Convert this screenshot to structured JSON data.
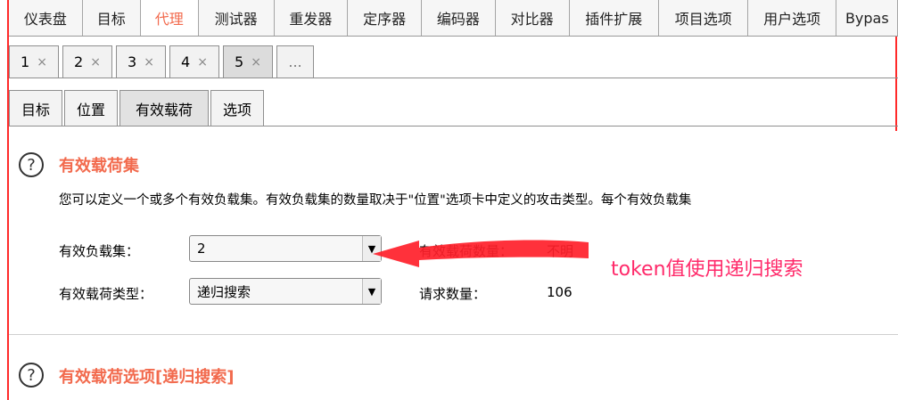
{
  "top_tabs": [
    {
      "label": "仪表盘"
    },
    {
      "label": "目标"
    },
    {
      "label": "代理"
    },
    {
      "label": "测试器"
    },
    {
      "label": "重发器"
    },
    {
      "label": "定序器"
    },
    {
      "label": "编码器"
    },
    {
      "label": "对比器"
    },
    {
      "label": "插件扩展"
    },
    {
      "label": "项目选项"
    },
    {
      "label": "用户选项"
    },
    {
      "label": "Bypas"
    }
  ],
  "num_tabs": [
    {
      "label": "1",
      "close": "×"
    },
    {
      "label": "2",
      "close": "×"
    },
    {
      "label": "3",
      "close": "×"
    },
    {
      "label": "4",
      "close": "×"
    },
    {
      "label": "5",
      "close": "×"
    },
    {
      "label": "..."
    }
  ],
  "sub_tabs": [
    {
      "label": "目标"
    },
    {
      "label": "位置"
    },
    {
      "label": "有效载荷"
    },
    {
      "label": "选项"
    }
  ],
  "payload_sets": {
    "help": "?",
    "title": "有效载荷集",
    "description": "您可以定义一个或多个有效负载集。有效负载集的数量取决于\"位置\"选项卡中定义的攻击类型。每个有效负载集",
    "set_label": "有效负载集：",
    "set_value": "2",
    "type_label": "有效载荷类型：",
    "type_value": "递归搜索",
    "count_label": "有效载荷数量：",
    "count_value": "不明",
    "requests_label": "请求数量：",
    "requests_value": "106"
  },
  "payload_options": {
    "help": "?",
    "title": "有效载荷选项[递归搜索]"
  },
  "annotation": "token值使用递归搜索",
  "colors": {
    "accent": "#f26a4d",
    "annotation": "#ff2a6a",
    "frame": "#ff2a2a"
  }
}
